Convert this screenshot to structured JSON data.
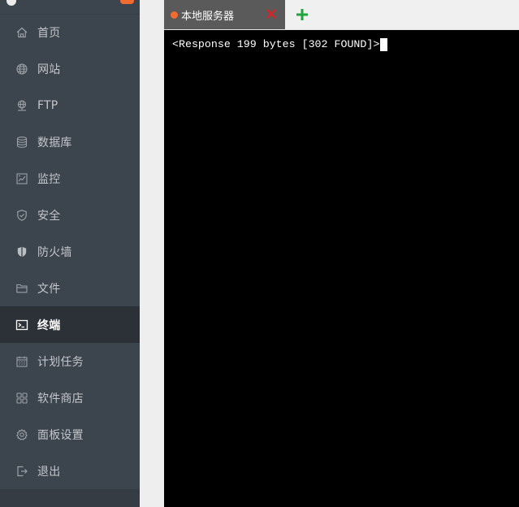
{
  "sidebar": {
    "items": [
      {
        "label": "首页",
        "icon": "home-icon",
        "active": false
      },
      {
        "label": "网站",
        "icon": "globe-icon",
        "active": false
      },
      {
        "label": "FTP",
        "icon": "ftp-icon",
        "active": false
      },
      {
        "label": "数据库",
        "icon": "database-icon",
        "active": false
      },
      {
        "label": "监控",
        "icon": "monitor-icon",
        "active": false
      },
      {
        "label": "安全",
        "icon": "shield-check-icon",
        "active": false
      },
      {
        "label": "防火墙",
        "icon": "firewall-shield-icon",
        "active": false
      },
      {
        "label": "文件",
        "icon": "folder-icon",
        "active": false
      },
      {
        "label": "终端",
        "icon": "terminal-icon",
        "active": true
      },
      {
        "label": "计划任务",
        "icon": "calendar-icon",
        "active": false
      },
      {
        "label": "软件商店",
        "icon": "app-grid-icon",
        "active": false
      },
      {
        "label": "面板设置",
        "icon": "gear-icon",
        "active": false
      },
      {
        "label": "退出",
        "icon": "logout-icon",
        "active": false
      }
    ]
  },
  "terminal": {
    "tabs": [
      {
        "label": "本地服务器",
        "status_color": "#f26b2f"
      }
    ],
    "close_icon": "close-icon",
    "add_icon": "plus-icon",
    "output_line": "<Response 199 bytes [302 FOUND]>"
  },
  "colors": {
    "sidebar_bg": "#3c444d",
    "sidebar_active_bg": "#2c3138",
    "sidebar_text": "#c3c7cb",
    "tab_active_bg": "#5a5a5a",
    "tab_close": "#e02020",
    "add_tab": "#20a53a",
    "terminal_bg": "#000000",
    "accent_orange": "#f26b2f"
  }
}
